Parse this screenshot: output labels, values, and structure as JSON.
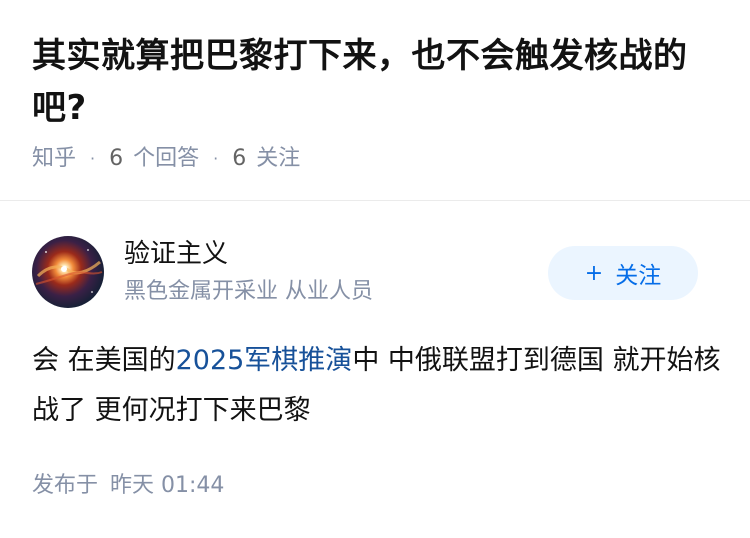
{
  "question": {
    "title": "其实就算把巴黎打下来，也不会触发核战的吧?",
    "meta": {
      "site": "知乎",
      "answers_count": "6",
      "answers_label": "个回答",
      "followers_count": "6",
      "followers_label": "关注"
    }
  },
  "author": {
    "name": "验证主义",
    "description": "黑色金属开采业 从业人员",
    "follow_plus": "+",
    "follow_label": "关注"
  },
  "answer": {
    "text_before": "会 在美国的",
    "link_text": "2025军棋推演",
    "text_after": "中 中俄联盟打到德国 就开始核战了 更何况打下来巴黎",
    "published_label": "发布于",
    "published_time": "昨天 01:44"
  },
  "colors": {
    "accent": "#056de8",
    "link": "#175199",
    "muted": "#8590a6"
  }
}
